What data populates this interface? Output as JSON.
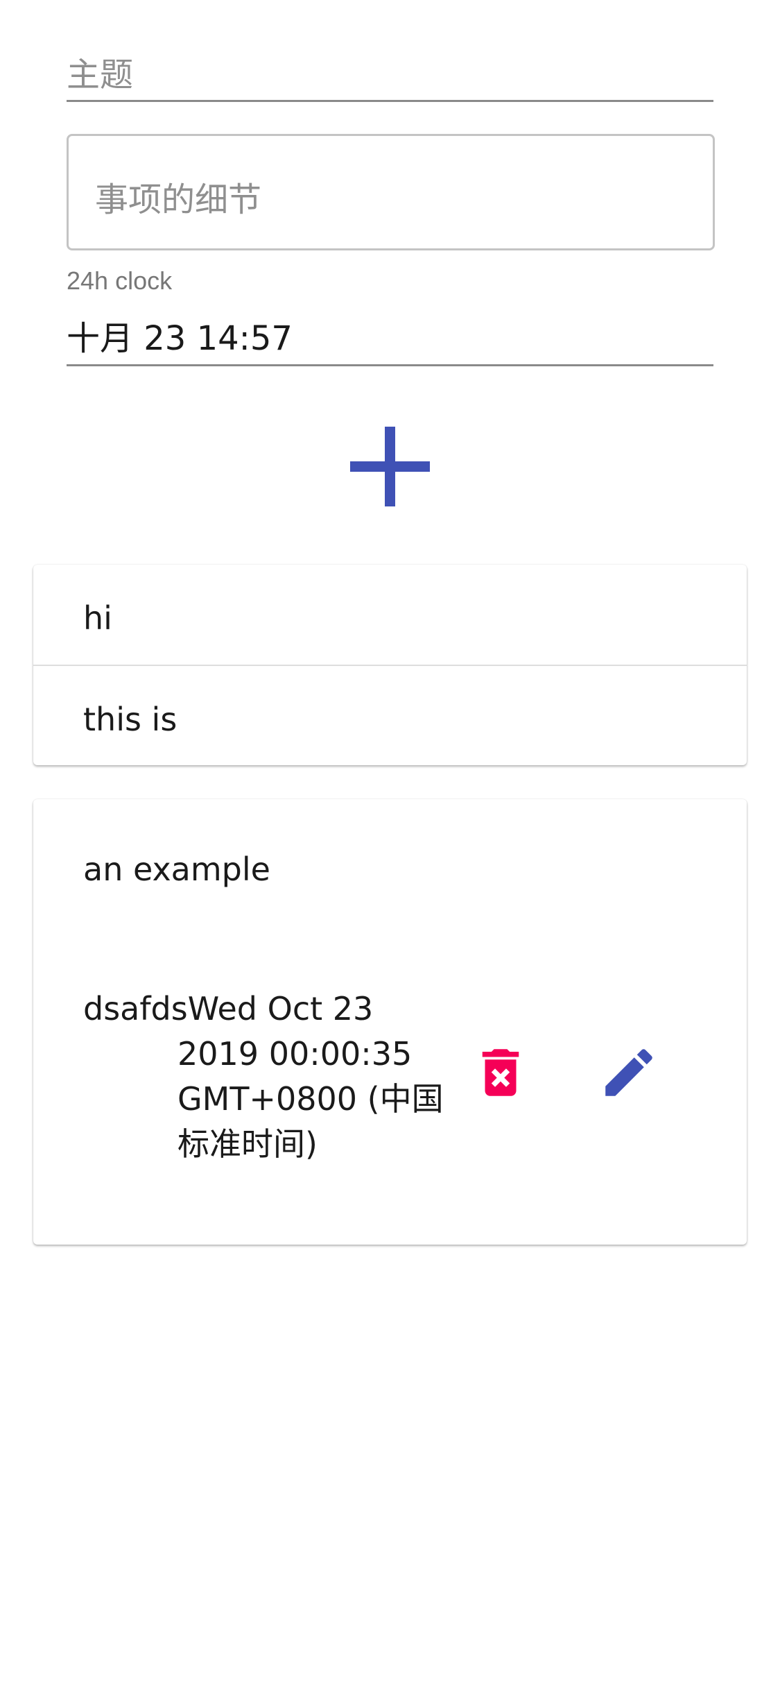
{
  "form": {
    "subject_placeholder": "主题",
    "details_placeholder": "事项的细节",
    "clock_label": "24h clock",
    "datetime_value": "十月 23 14:57",
    "add_icon": "plus-icon",
    "accent_color": "#3f51b5"
  },
  "list": {
    "items": [
      {
        "label": "hi"
      },
      {
        "label": "this is"
      }
    ]
  },
  "detail": {
    "title": "an example",
    "body_first": "dsafdsWed Oct 23",
    "body_rest": "2019 00:00:35 GMT+0800 (中国标准时间)",
    "delete_icon": "delete-forever-icon",
    "edit_icon": "pencil-icon",
    "delete_color": "#f50057",
    "edit_color": "#3f51b5"
  }
}
